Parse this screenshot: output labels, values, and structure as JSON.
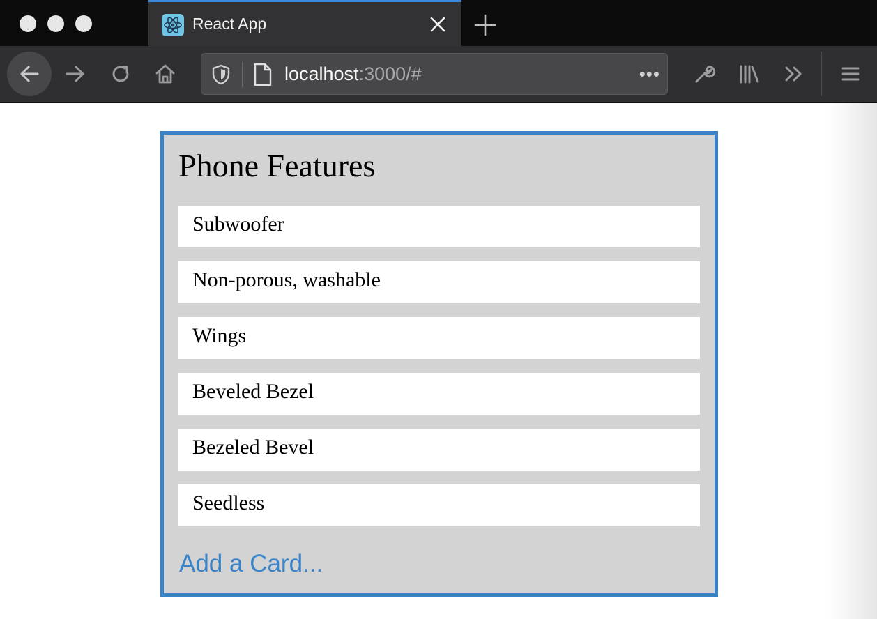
{
  "browser": {
    "tab": {
      "title": "React App",
      "favicon": "react-atom-icon"
    },
    "url": {
      "host": "localhost",
      "rest": ":3000/#"
    },
    "url_more": "•••",
    "colors": {
      "accent": "#3d8be0",
      "tab_bg": "#323234",
      "toolbar_bg": "#2f2f31"
    }
  },
  "page": {
    "list": {
      "title": "Phone Features",
      "cards": [
        {
          "text": "Subwoofer"
        },
        {
          "text": "Non-porous, washable"
        },
        {
          "text": "Wings"
        },
        {
          "text": "Beveled Bezel"
        },
        {
          "text": "Bezeled Bevel"
        },
        {
          "text": "Seedless"
        }
      ],
      "add_card_label": "Add a Card...",
      "colors": {
        "border": "#3b83c8",
        "background": "#d3d3d3",
        "link": "#3b83c8"
      }
    }
  }
}
